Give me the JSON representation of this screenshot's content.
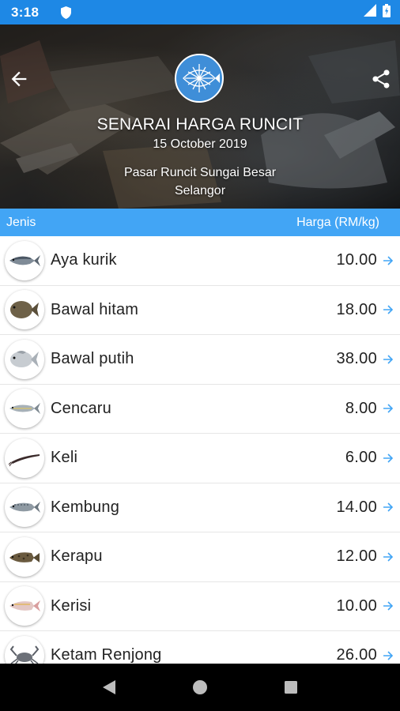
{
  "status": {
    "time": "3:18"
  },
  "header": {
    "title": "SENARAI HARGA RUNCIT",
    "date": "15 October 2019",
    "market_line1": "Pasar Runcit Sungai Besar",
    "market_line2": "Selangor"
  },
  "columns": {
    "type": "Jenis",
    "price": "Harga (RM/kg)"
  },
  "items": [
    {
      "name": "Aya kurik",
      "price": "10.00",
      "icon": "tuna-fish-icon"
    },
    {
      "name": "Bawal hitam",
      "price": "18.00",
      "icon": "black-pomfret-icon"
    },
    {
      "name": "Bawal putih",
      "price": "38.00",
      "icon": "white-pomfret-icon"
    },
    {
      "name": "Cencaru",
      "price": "8.00",
      "icon": "scad-fish-icon"
    },
    {
      "name": "Keli",
      "price": "6.00",
      "icon": "catfish-icon"
    },
    {
      "name": "Kembung",
      "price": "14.00",
      "icon": "mackerel-icon"
    },
    {
      "name": "Kerapu",
      "price": "12.00",
      "icon": "grouper-icon"
    },
    {
      "name": "Kerisi",
      "price": "10.00",
      "icon": "threadfin-bream-icon"
    },
    {
      "name": "Ketam Renjong",
      "price": "26.00",
      "icon": "crab-icon"
    }
  ],
  "colors": {
    "status_bar": "#1e88e5",
    "header_bar": "#42a5f5",
    "arrow": "#42a5f5"
  }
}
